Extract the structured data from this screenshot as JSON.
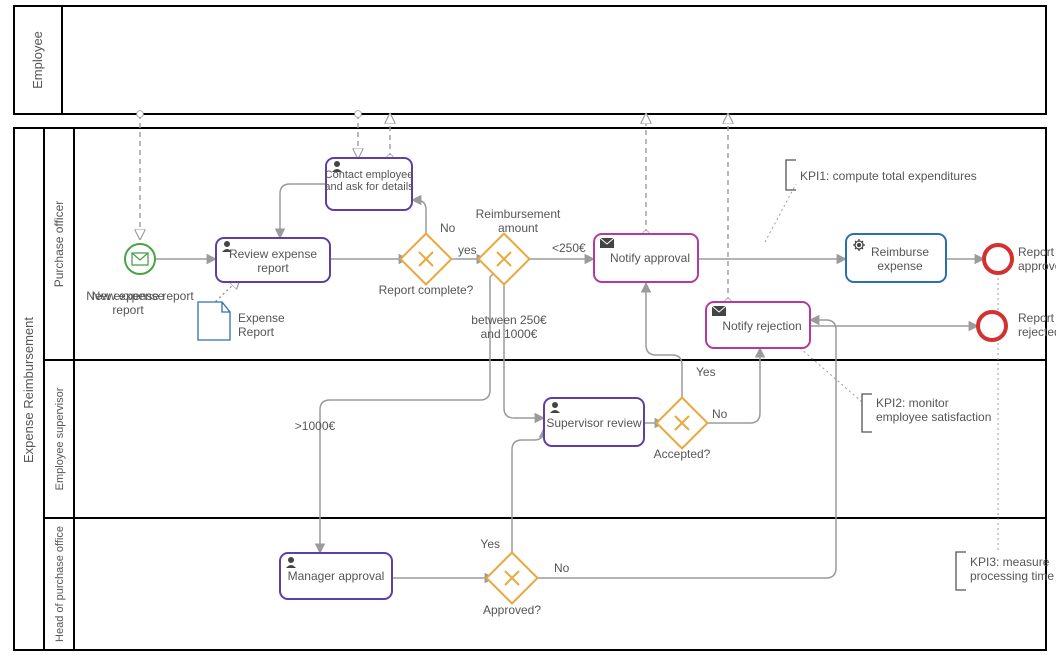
{
  "pools": {
    "employee": "Employee",
    "expense": "Expense Reimbursement"
  },
  "lanes": {
    "purchase_officer": "Purchase officer",
    "employee_supervisor": "Employee supervisor",
    "head_of_purchase": "Head of purchase office"
  },
  "events": {
    "start_label": "New expense report",
    "end_approved": "Report approved",
    "end_rejected": "Report rejected"
  },
  "tasks": {
    "review_expense": "Review expense report",
    "contact_employee": "Contact employee and ask for details",
    "notify_approval": "Notify approval",
    "reimburse_expense": "Reimburse expense",
    "notify_rejection": "Notify rejection",
    "supervisor_review": "Supervisor review",
    "manager_approval": "Manager approval"
  },
  "data": {
    "expense_report": "Expense Report"
  },
  "gateways": {
    "report_complete": "Report complete?",
    "reimbursement_amount": "Reimbursement amount",
    "accepted": "Accepted?",
    "approved": "Approved?"
  },
  "flows": {
    "no1": "No",
    "yes1": "yes",
    "lt250": "<250€",
    "between": "between 250€ and 1000€",
    "gt1000": ">1000€",
    "yes2": "Yes",
    "no2": "No",
    "yes3": "Yes",
    "no3": "No"
  },
  "kpi": {
    "kpi1": "KPI1: compute total expenditures",
    "kpi2": "KPI2: monitor employee satisfaction",
    "kpi3": "KPI3: measure processing time"
  },
  "colors": {
    "task_purple": "#5d3fa7",
    "task_pink": "#b63a9e",
    "task_blue": "#2b6fb3",
    "gateway": "#e8a83c",
    "start": "#4aa24a",
    "end": "#d43030",
    "data": "#2b6fb3",
    "flow": "#9b9b9b",
    "text": "#555"
  }
}
